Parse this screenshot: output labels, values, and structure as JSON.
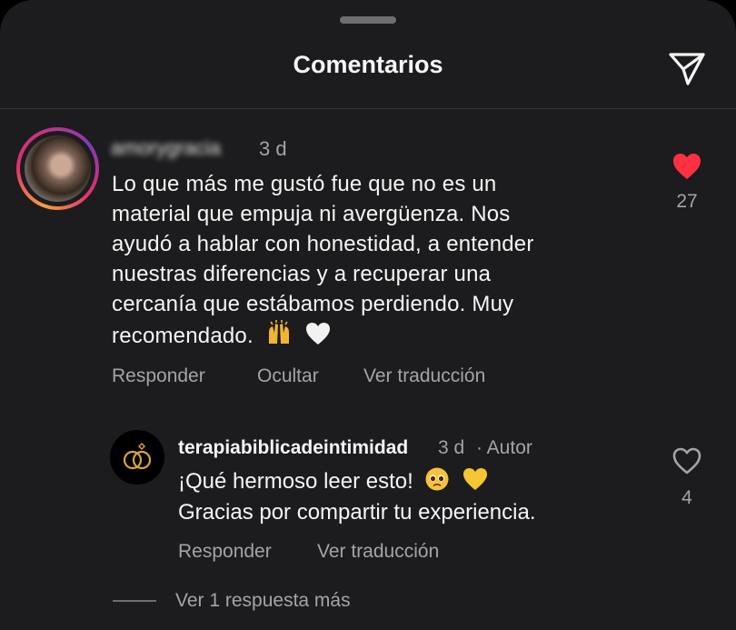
{
  "header": {
    "title": "Comentarios"
  },
  "comment": {
    "username": "amorygracia",
    "time": "3 d",
    "lines": [
      "Lo que más me gustó fue que no es un",
      "material que empuja ni avergüenza. Nos",
      "ayudó a hablar con honestidad, a entender",
      "nuestras diferencias y a recuperar una",
      "cercanía que estábamos perdiendo. Muy",
      "recomendado."
    ],
    "likes": "27",
    "liked": true,
    "actions": {
      "reply": "Responder",
      "hide": "Ocultar",
      "translate": "Ver traducción"
    }
  },
  "reply": {
    "username": "terapiabiblicadeintimidad",
    "time": "3 d",
    "author_badge": "· Autor",
    "line1": "¡Qué hermoso leer esto!",
    "line2": "Gracias por compartir tu experiencia.",
    "likes": "4",
    "liked": false,
    "actions": {
      "reply": "Responder",
      "translate": "Ver traducción"
    }
  },
  "more_replies": "Ver 1 respuesta más",
  "colors": {
    "background": "#1c1c1e",
    "like_red": "#ff3040",
    "muted_text": "#a4a4a8",
    "accent_gold": "#d8a531"
  },
  "icons": {
    "share": "paper-plane-icon",
    "like": "heart-icon",
    "emoji1": "raising-hands-emoji",
    "emoji2": "white-heart-emoji",
    "emoji3": "pleading-face-emoji",
    "emoji4": "yellow-heart-emoji",
    "reply_avatar": "wedding-rings-logo"
  }
}
